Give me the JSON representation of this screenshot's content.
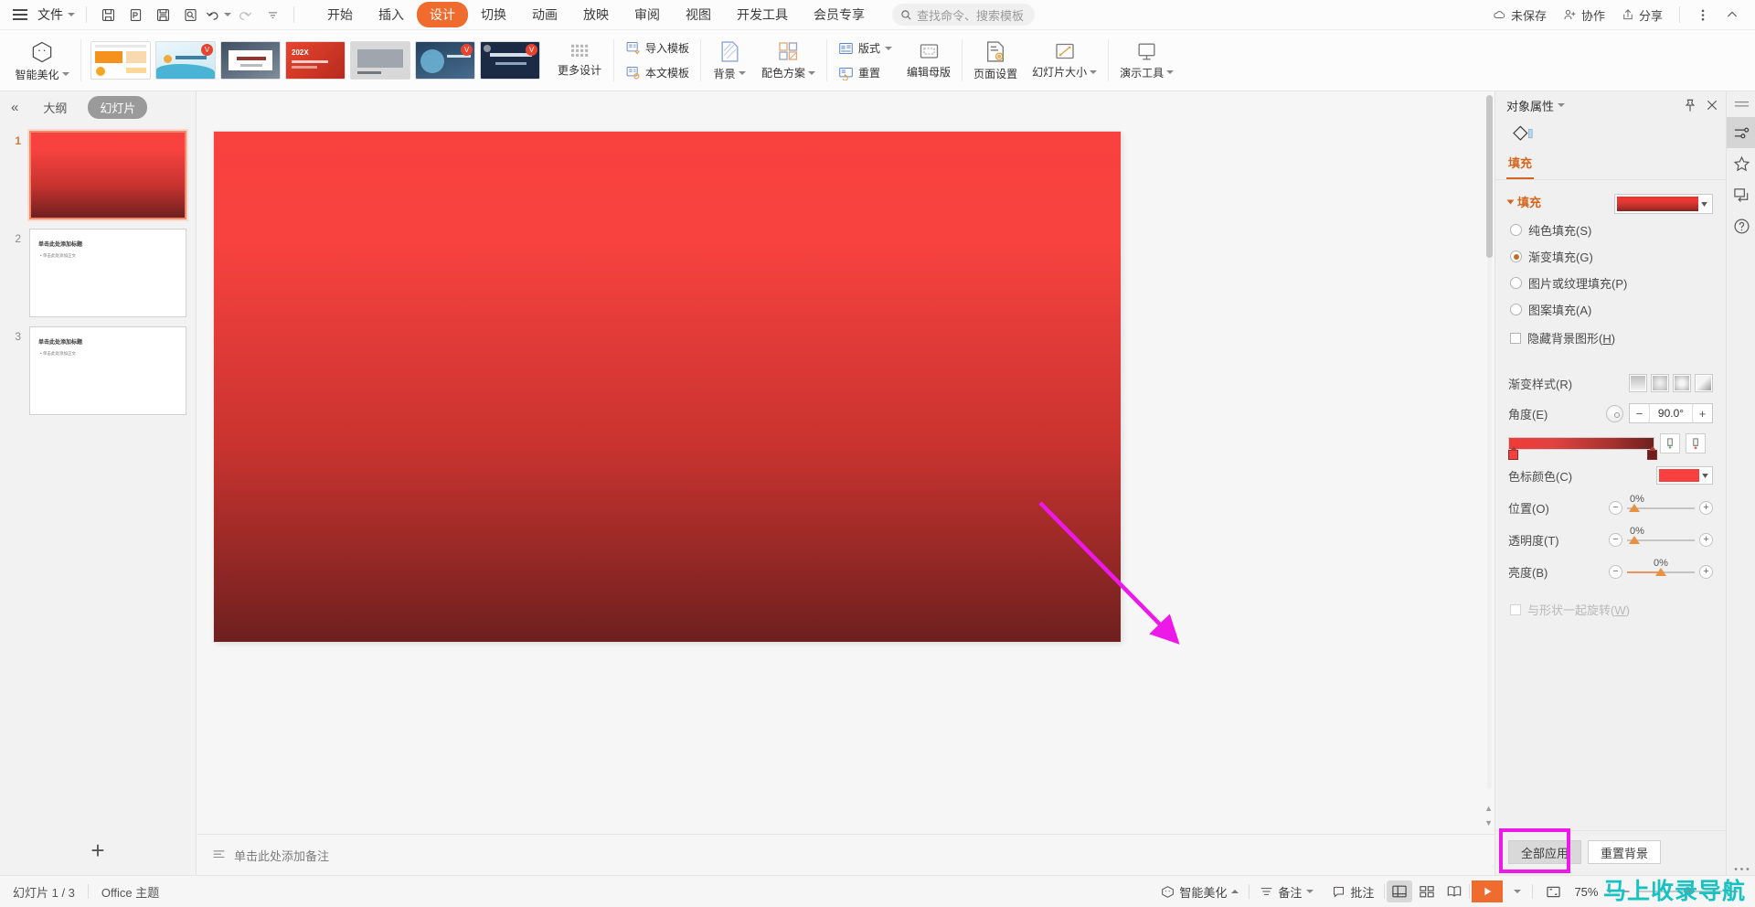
{
  "topbar": {
    "file_label": "文件",
    "quick_icons": [
      "save-icon",
      "export-pdf-icon",
      "print-icon",
      "print-preview-icon",
      "undo-icon",
      "redo-icon",
      "customize-icon"
    ],
    "menus": [
      {
        "label": "开始",
        "active": false
      },
      {
        "label": "插入",
        "active": false
      },
      {
        "label": "设计",
        "active": true
      },
      {
        "label": "切换",
        "active": false
      },
      {
        "label": "动画",
        "active": false
      },
      {
        "label": "放映",
        "active": false
      },
      {
        "label": "审阅",
        "active": false
      },
      {
        "label": "视图",
        "active": false
      },
      {
        "label": "开发工具",
        "active": false
      },
      {
        "label": "会员专享",
        "active": false
      }
    ],
    "search_placeholder": "查找命令、搜索模板",
    "right_items": [
      {
        "label": "未保存",
        "icon": "cloud-unsaved-icon"
      },
      {
        "label": "协作",
        "icon": "collaborate-icon"
      },
      {
        "label": "分享",
        "icon": "share-icon"
      }
    ],
    "more_icon": "more-vertical-icon",
    "collapse_icon": "chevron-up-icon"
  },
  "ribbon": {
    "beautify_label": "智能美化",
    "templates": [
      {
        "name": "template-orange",
        "badge": ""
      },
      {
        "name": "template-blue-wave",
        "badge": "V"
      },
      {
        "name": "template-white-frame",
        "badge": ""
      },
      {
        "name": "template-2024-red",
        "badge": ""
      },
      {
        "name": "template-gray-office",
        "badge": ""
      },
      {
        "name": "template-city",
        "badge": "V"
      },
      {
        "name": "template-navy",
        "badge": "V"
      }
    ],
    "more_design_label": "更多设计",
    "import_template_label": "导入模板",
    "text_template_label": "本文模板",
    "background_label": "背景",
    "color_scheme_label": "配色方案",
    "layout_label": "版式",
    "reset_label": "重置",
    "edit_master_label": "编辑母版",
    "page_setup_label": "页面设置",
    "slide_size_label": "幻灯片大小",
    "present_tools_label": "演示工具"
  },
  "left_panel": {
    "collapse_icon": "double-chevron-left-icon",
    "tabs": [
      {
        "label": "大纲",
        "active": false
      },
      {
        "label": "幻灯片",
        "active": true
      }
    ],
    "slides": [
      {
        "num": "1",
        "selected": true,
        "title": "",
        "sub": "",
        "type": "gradient-red"
      },
      {
        "num": "2",
        "selected": false,
        "title": "单击此处添加标题",
        "sub": "• 单击此处添加正文",
        "type": "white"
      },
      {
        "num": "3",
        "selected": false,
        "title": "单击此处添加标题",
        "sub": "• 单击此处添加正文",
        "type": "white"
      }
    ],
    "add_slide_icon": "plus-icon"
  },
  "canvas": {
    "notes_placeholder": "单击此处添加备注",
    "notes_icon": "notes-icon"
  },
  "right_panel": {
    "title": "对象属性",
    "pin_icon": "pin-icon",
    "close_icon": "close-icon",
    "shape_icon": "shape-fill-icon",
    "tabs": [
      {
        "label": "填充",
        "active": true
      }
    ],
    "section_title": "填充",
    "fill_swatch_label": "fill-gradient-swatch",
    "fill_options": [
      {
        "label": "纯色填充(S)",
        "accel": "S",
        "text": "纯色填充",
        "selected": false
      },
      {
        "label": "渐变填充(G)",
        "accel": "G",
        "text": "渐变填充",
        "selected": true
      },
      {
        "label": "图片或纹理填充(P)",
        "accel": "P",
        "text": "图片或纹理填充",
        "selected": false
      },
      {
        "label": "图案填充(A)",
        "accel": "A",
        "text": "图案填充",
        "selected": false
      }
    ],
    "hide_bg_checkbox": {
      "text": "隐藏背景图形",
      "accel": "H",
      "checked": false
    },
    "gradient_style_label": "渐变样式(R)",
    "gradient_styles": [
      "linear",
      "radial",
      "rectangular",
      "path"
    ],
    "angle_label": "角度(E)",
    "angle_value": "90.0°",
    "minus_label": "−",
    "plus_label": "+",
    "stop_color_label": "色标颜色(C)",
    "stop_color_hex": "#f8413e",
    "position_label": "位置(O)",
    "position_value": "0%",
    "transparency_label": "透明度(T)",
    "transparency_value": "0%",
    "brightness_label": "亮度(B)",
    "brightness_value": "0%",
    "rotate_with_shape": {
      "text": "与形状一起旋转",
      "accel": "W",
      "checked": false,
      "disabled": true
    },
    "apply_all_label": "全部应用",
    "reset_bg_label": "重置背景",
    "add_stop_icon": "add-stop-icon",
    "remove_stop_icon": "remove-stop-icon"
  },
  "rail": {
    "icons": [
      {
        "name": "panel-toggle-icon",
        "selected": false
      },
      {
        "name": "object-properties-icon",
        "selected": true
      },
      {
        "name": "star-effects-icon",
        "selected": false
      },
      {
        "name": "slide-transition-icon",
        "selected": false
      },
      {
        "name": "help-icon",
        "selected": false
      }
    ],
    "bottom_icon": "more-horizontal-icon"
  },
  "statusbar": {
    "slide_count": "幻灯片 1 / 3",
    "theme": "Office 主题",
    "beautify_label": "智能美化",
    "notes_label": "备注",
    "comment_label": "批注",
    "views": [
      {
        "name": "normal-view-icon",
        "selected": true
      },
      {
        "name": "slide-sorter-icon",
        "selected": false
      },
      {
        "name": "reading-view-icon",
        "selected": false
      }
    ],
    "play_icon": "play-icon",
    "zoom_level": "75%",
    "fit_icon": "fit-slide-icon",
    "zoom_minus": "−",
    "zoom_plus": "+",
    "watermark": "马上收录导航"
  }
}
